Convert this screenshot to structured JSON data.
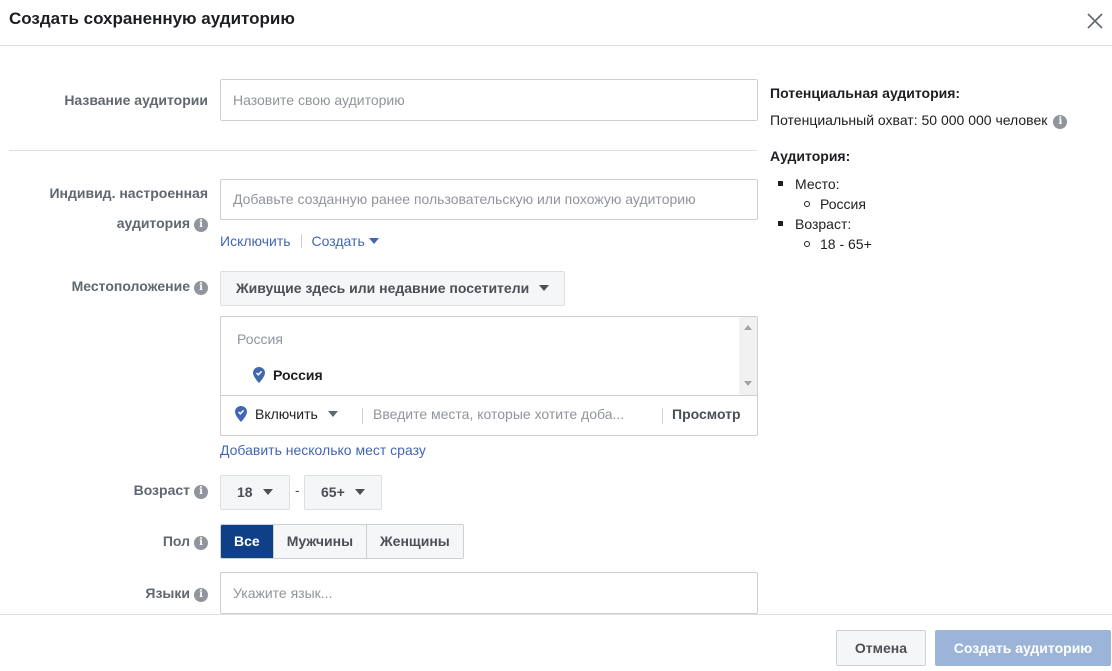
{
  "dialog": {
    "title": "Создать сохраненную аудиторию",
    "close_icon": "close-icon"
  },
  "form": {
    "audience_name": {
      "label": "Название аудитории",
      "placeholder": "Назовите свою аудиторию"
    },
    "custom_audience": {
      "label_line1": "Индивид. настроенная",
      "label_line2": "аудитория",
      "placeholder": "Добавьте созданную ранее пользовательскую или похожую аудиторию",
      "exclude_link": "Исключить",
      "create_link": "Создать"
    },
    "location": {
      "label": "Местоположение",
      "type_dropdown": "Живущие здесь или недавние посетители",
      "group_header": "Россия",
      "selected_item": "Россия",
      "include_dropdown": "Включить",
      "search_placeholder": "Введите места, которые хотите доба...",
      "browse_label": "Просмотр",
      "bulk_add_link": "Добавить несколько мест сразу"
    },
    "age": {
      "label": "Возраст",
      "min": "18",
      "separator": "-",
      "max": "65+"
    },
    "gender": {
      "label": "Пол",
      "options": [
        "Все",
        "Мужчины",
        "Женщины"
      ],
      "selected": "Все"
    },
    "languages": {
      "label": "Языки",
      "placeholder": "Укажите язык..."
    }
  },
  "summary": {
    "title": "Потенциальная аудитория:",
    "reach": "Потенциальный охват: 50 000 000 человек",
    "audience_header": "Аудитория:",
    "location_label": "Место:",
    "location_value": "Россия",
    "age_label": "Возраст:",
    "age_value": "18 - 65+"
  },
  "footer": {
    "cancel_label": "Отмена",
    "create_label": "Создать аудиторию"
  },
  "colors": {
    "accent": "#4267b2",
    "selected_segment": "#0e3f87",
    "disabled_primary": "#9cb4d8"
  }
}
